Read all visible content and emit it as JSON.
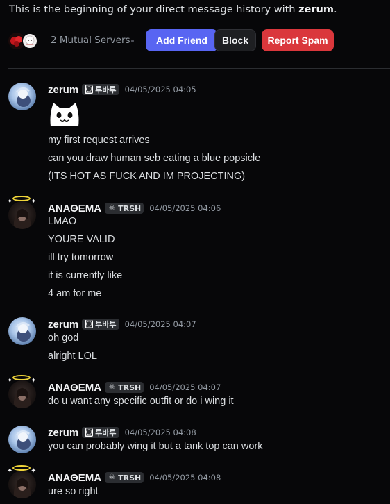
{
  "intro": {
    "prefix": "This is the beginning of your direct message history with ",
    "name": "zerum",
    "suffix": "."
  },
  "profile_actions": {
    "mutual_servers": "2 Mutual Servers",
    "add_friend": "Add Friend",
    "block": "Block",
    "report_spam": "Report Spam"
  },
  "users": {
    "zerum": {
      "name": "zerum",
      "tag": "투바투"
    },
    "anathema": {
      "name": "ΑΝΑΘΕΜΑ",
      "tag": "TRSH"
    }
  },
  "messages": [
    {
      "author": "zerum",
      "timestamp": "04/05/2025 04:05",
      "emoji": "cat-face-emoji",
      "lines": [
        "my first request arrives",
        "can you draw human seb eating a blue popsicle",
        "(ITS HOT AS FUCK AND IM PROJECTING)"
      ]
    },
    {
      "author": "anathema",
      "timestamp": "04/05/2025 04:06",
      "lines": [
        "LMAO",
        "YOURE VALID",
        "ill try tomorrow",
        "it is currently like",
        "4 am for me"
      ]
    },
    {
      "author": "zerum",
      "timestamp": "04/05/2025 04:07",
      "lines": [
        "oh god",
        "alright LOL"
      ]
    },
    {
      "author": "anathema",
      "timestamp": "04/05/2025 04:07",
      "lines": [
        "do u want any specific outfit or do i wing it"
      ]
    },
    {
      "author": "zerum",
      "timestamp": "04/05/2025 04:08",
      "lines": [
        "you can probably wing it but a tank top can work"
      ]
    },
    {
      "author": "anathema",
      "timestamp": "04/05/2025 04:08",
      "lines": [
        "ure so right"
      ]
    }
  ],
  "colors": {
    "background": "#070709",
    "add_friend": "#5865f2",
    "report_spam": "#da373c",
    "halo": "#f0d53a"
  }
}
